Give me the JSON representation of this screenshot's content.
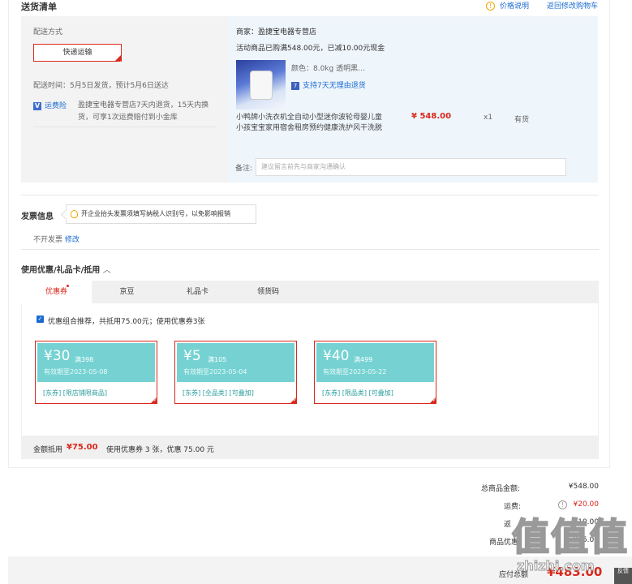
{
  "header": {
    "title": "送货清单",
    "price_explain": "价格说明",
    "back_cart": "返回修改购物车"
  },
  "shipping": {
    "method_label": "配送方式",
    "method_value": "快递运输",
    "time_text": "配送时间：5月5日发货，预计5月6日送达",
    "freight_label": "运费险",
    "freight_text_1": "盈捷宝电器专营店7天内退货，15天内换",
    "freight_text_2": "货，可享1次运费赔付到小金库"
  },
  "order": {
    "shop": "商家：盈捷宝电器专营店",
    "promo": "活动商品已购满548.00元，已减10.00元现金",
    "color": "颜色：8.0kg 透明黑…",
    "return_tag": "7",
    "return_text": "支持7天无理由退货",
    "name_1": "小鸭牌小洗衣机全自动小型迷你波轮母婴儿童",
    "name_2": "小孩宝宝家用宿舍租房预约健康洗护风干洗脱",
    "price": "¥ 548.00",
    "qty": "x1",
    "stock": "有货",
    "remark_label": "备注:",
    "remark_placeholder": "建议留言前先与商家沟通确认"
  },
  "invoice": {
    "title": "发票信息",
    "tip": "开企业抬头发票须填写纳税人识别号，以免影响报销",
    "status": "不开发票",
    "modify": "修改"
  },
  "discount": {
    "title": "使用优惠/礼品卡/抵用",
    "arrow": "︿",
    "tabs": [
      "优惠券",
      "京豆",
      "礼品卡",
      "领货码"
    ],
    "recommend": "优惠组合推荐，共抵用75.00元；使用优惠券3张",
    "coupons": [
      {
        "amount": "¥30",
        "limit": "满398",
        "date": "有效期至2023-05-08",
        "tags": "[东券]  [限店铺限商品]"
      },
      {
        "amount": "¥5",
        "limit": "满105",
        "date": "有效期至2023-05-04",
        "tags": "[东券]  [全品类]  [可叠加]"
      },
      {
        "amount": "¥40",
        "limit": "满499",
        "date": "有效期至2023-05-22",
        "tags": "[东券]  [限品类]  [可叠加]"
      }
    ],
    "sum_label": "金额抵用",
    "sum_value": "¥75.00",
    "sum_text": "使用优惠券 3 张，优惠 75.00 元"
  },
  "totals": {
    "goods_label": "总商品金额:",
    "goods_value": "¥548.00",
    "freight_label": "运费:",
    "freight_value": "¥20.00",
    "return_label": "返",
    "return_value": "¥10.00",
    "discount_label": "商品优惠",
    "discount_value": "¥75.00",
    "pay_label": "应付总额",
    "pay_value": "¥483.00"
  },
  "watermark": {
    "big": "值值值",
    "small": "zhizhi.com"
  },
  "side": {
    "label": "反馈"
  },
  "colors": {
    "accent": "#d9281c",
    "link": "#1a6bd0",
    "coupon": "#76d2d2"
  }
}
